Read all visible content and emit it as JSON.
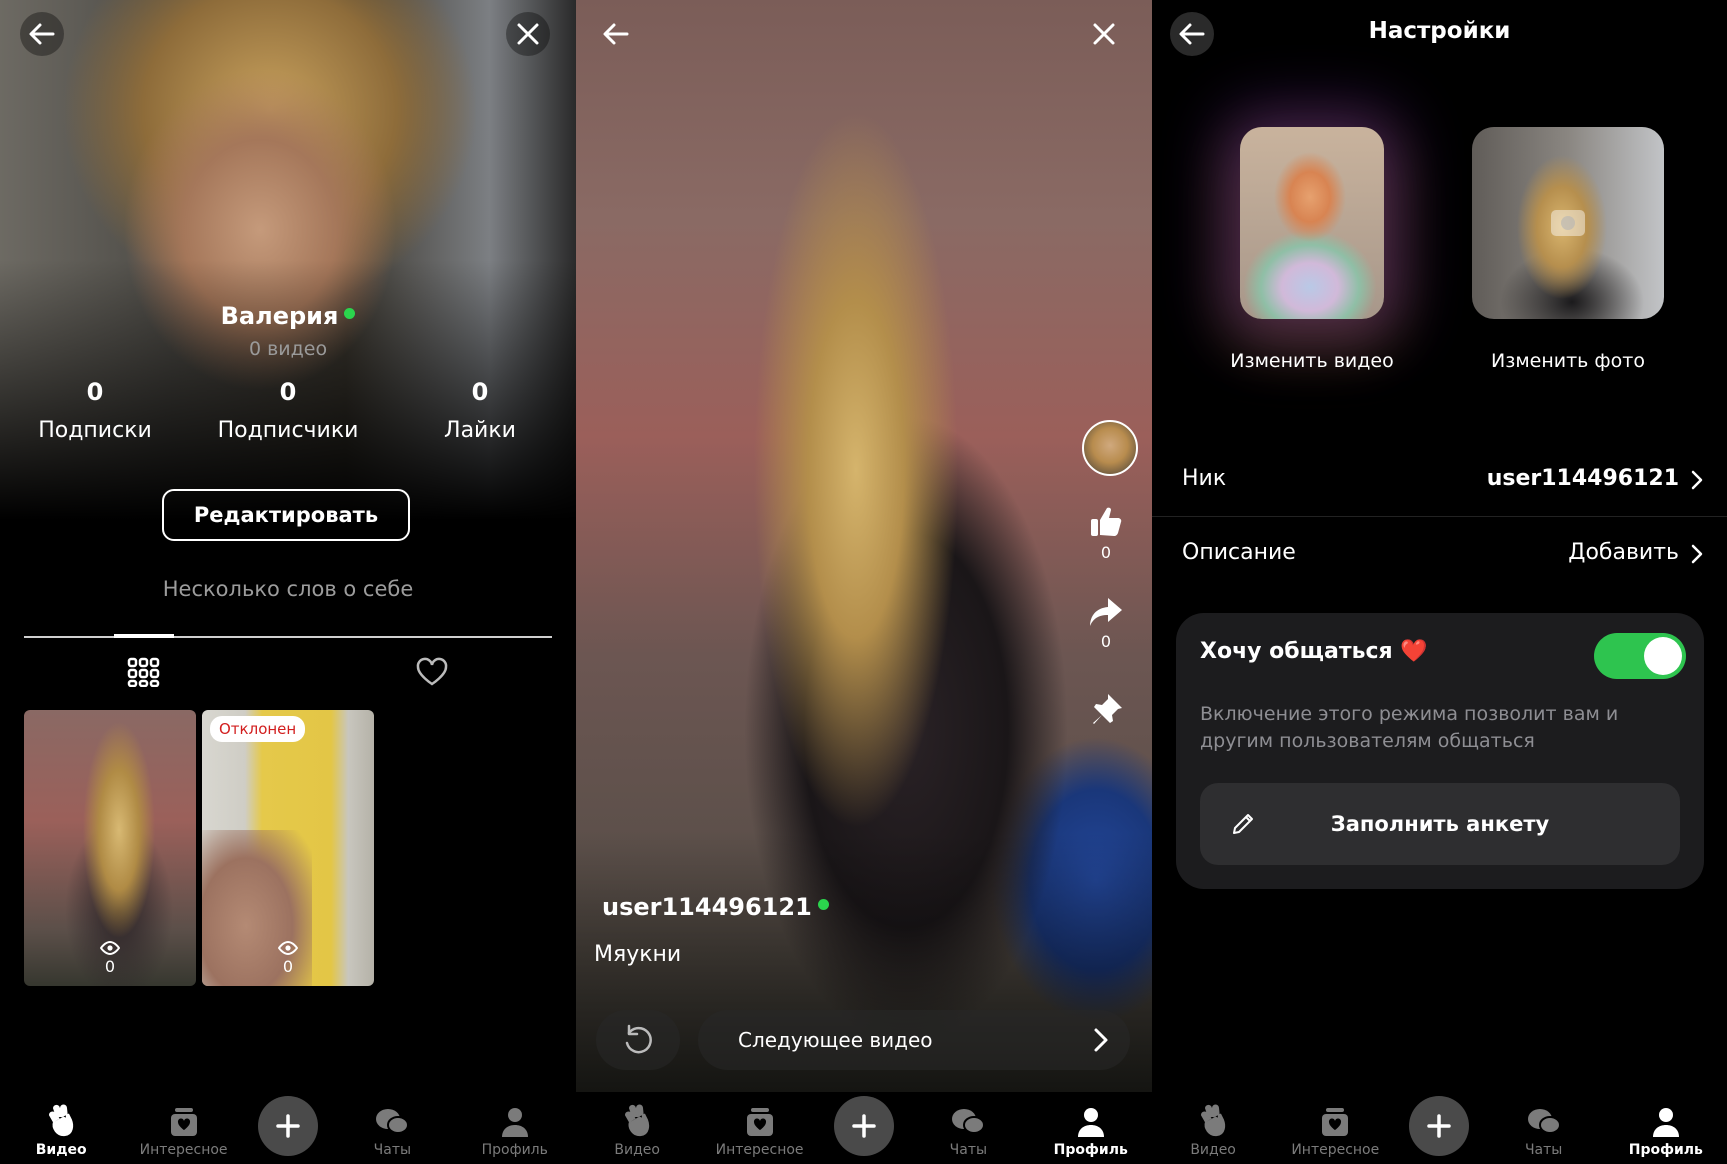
{
  "profile": {
    "name": "Валерия",
    "video_count": "0 видео",
    "stats": [
      {
        "value": "0",
        "label": "Подписки"
      },
      {
        "value": "0",
        "label": "Подписчики"
      },
      {
        "value": "0",
        "label": "Лайки"
      }
    ],
    "edit_label": "Редактировать",
    "bio_placeholder": "Несколько слов о себе",
    "thumbs": [
      {
        "views": "0",
        "badge": ""
      },
      {
        "views": "0",
        "badge": "Отклонен"
      }
    ]
  },
  "player": {
    "likes": "0",
    "shares": "0",
    "username": "user114496121",
    "description": "Мяукни",
    "next_label": "Следующее видео"
  },
  "settings": {
    "title": "Настройки",
    "change_video": "Изменить видео",
    "change_photo": "Изменить фото",
    "nick_label": "Ник",
    "nick_value": "user114496121",
    "desc_label": "Описание",
    "desc_value": "Добавить",
    "chat_title": "Хочу общаться ❤️",
    "chat_toggle_on": true,
    "chat_desc": "Включение этого режима позволит вам и другим пользователям общаться",
    "fill_label": "Заполнить анкету"
  },
  "nav": [
    "Видео",
    "Интересное",
    "Чаты",
    "Профиль"
  ],
  "colors": {
    "online": "#2bd44d",
    "toggle": "#2ec44f",
    "badge_text": "#d21e1e"
  }
}
